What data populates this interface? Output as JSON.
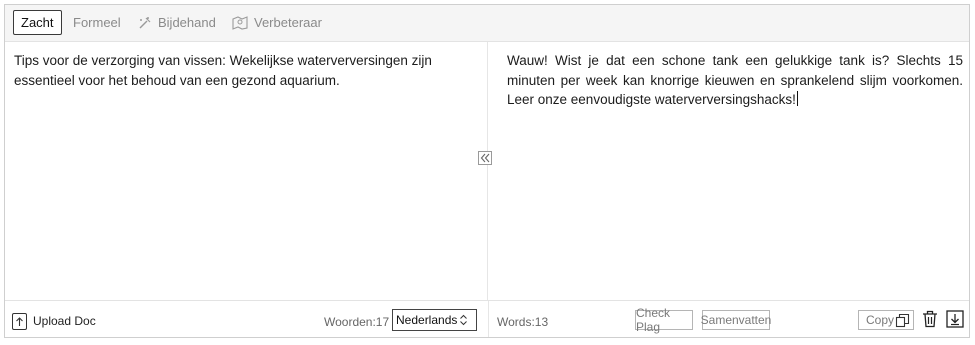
{
  "tabs": [
    {
      "label": "Zacht",
      "icon": null,
      "active": true
    },
    {
      "label": "Formeel",
      "icon": null,
      "active": false
    },
    {
      "label": "Bijdehand",
      "icon": "magic-wand-icon",
      "active": false
    },
    {
      "label": "Verbeteraar",
      "icon": "map-book-icon",
      "active": false
    }
  ],
  "input": {
    "text": "Tips voor de verzorging van vissen: Wekelijkse waterverversingen zijn essentieel voor het behoud van een gezond aquarium."
  },
  "output": {
    "text": "Wauw! Wist je dat een schone tank een gelukkige tank is? Slechts 15 minuten per week kan knorrige kieuwen en sprankelend slijm voorkomen. Leer onze eenvoudigste waterverversingshacks!"
  },
  "footer_left": {
    "upload_label": "Upload Doc",
    "word_count": "Woorden:17",
    "language": "Nederlands"
  },
  "footer_right": {
    "word_count": "Words:13",
    "check_plag": "Check Plag",
    "summarize": "Samenvatten",
    "copy": "Copy"
  },
  "icons": {
    "swap": "double-chevron-left-icon",
    "upload": "upload-icon",
    "select": "up-down-chevron-icon",
    "copy": "copy-icon",
    "delete": "trash-icon",
    "download": "download-icon"
  }
}
